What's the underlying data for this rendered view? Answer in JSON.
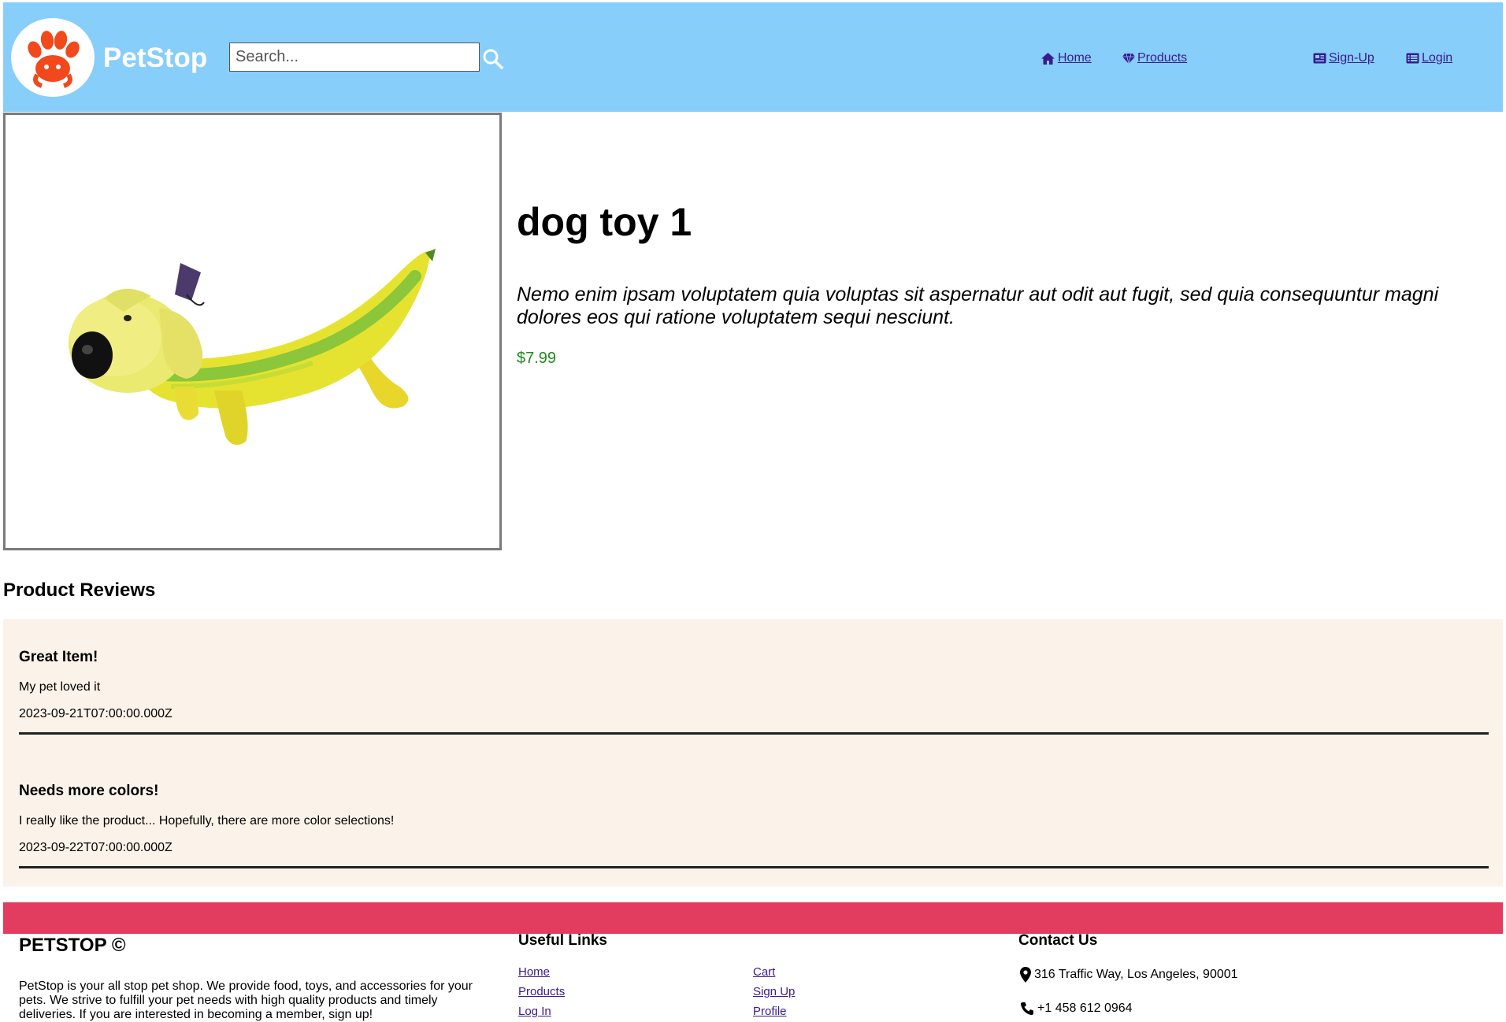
{
  "header": {
    "brand": "PetStop",
    "search_placeholder": "Search...",
    "nav": {
      "home": "Home",
      "products": "Products",
      "signup": "Sign-Up",
      "login": "Login"
    }
  },
  "product": {
    "title": "dog toy 1",
    "description": "Nemo enim ipsam voluptatem quia voluptas sit aspernatur aut odit aut fugit, sed quia consequuntur magni dolores eos qui ratione voluptatem sequi nesciunt.",
    "price": "$7.99",
    "image_icon": "banana-dog-toy-image"
  },
  "reviews": {
    "heading": "Product Reviews",
    "items": [
      {
        "title": "Great Item!",
        "body": "My pet loved it",
        "date": "2023-09-21T07:00:00.000Z"
      },
      {
        "title": "Needs more colors!",
        "body": "I really like the product... Hopefully, there are more color selections!",
        "date": "2023-09-22T07:00:00.000Z"
      }
    ]
  },
  "footer": {
    "brand": "PETSTOP ©",
    "about": "PetStop is your all stop pet shop. We provide food, toys, and accessories for your pets. We strive to fulfill your pet needs with high quality products and timely deliveries. If you are interested in becoming a member, sign up!",
    "useful_links_title": "Useful Links",
    "links_col1": [
      "Home",
      "Products",
      "Log In"
    ],
    "links_col2": [
      "Cart",
      "Sign Up",
      "Profile"
    ],
    "contact_title": "Contact Us",
    "address": "316 Traffic Way, Los Angeles, 90001",
    "phone": "+1 458 612 0964"
  },
  "colors": {
    "header_bg": "#87cefa",
    "logo_paw": "#f2491c",
    "link": "#3a1a8f",
    "price": "#1e8a1e",
    "reviews_bg": "#fbf3ea",
    "footer_band": "#e23d5e"
  }
}
